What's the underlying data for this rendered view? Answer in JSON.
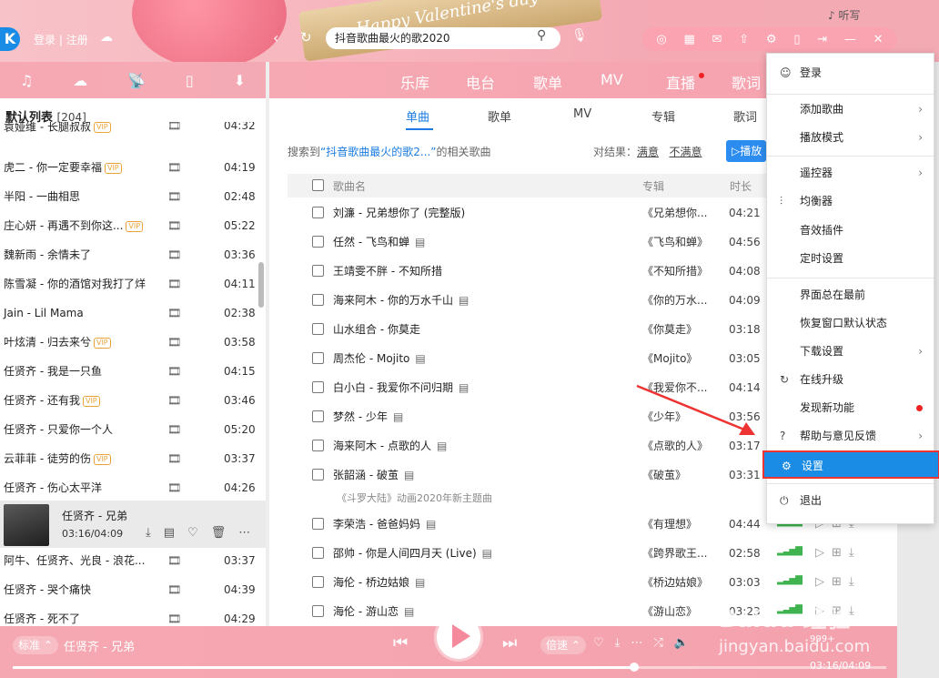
{
  "banner": {
    "decor_text": "Happy Valentine's day",
    "top_right_text": "♪ 听写"
  },
  "header": {
    "login": "登录",
    "register": "注册",
    "search_value": "抖音歌曲最火的歌2020"
  },
  "left_tabs": [
    "♫",
    "☁",
    "📡",
    "▯",
    "⬇"
  ],
  "playlist": {
    "title": "默认列表",
    "count": "[204]",
    "rows": [
      {
        "name": "袁娅维 - 长腿叔叔",
        "vip": "VIP",
        "duration": "04:32"
      },
      {
        "name": "虎二 - 你一定要幸福",
        "vip": "VIP",
        "duration": "04:19"
      },
      {
        "name": "半阳 - 一曲相思",
        "vip": "",
        "duration": "02:48"
      },
      {
        "name": "庄心妍 - 再遇不到你这...",
        "vip": "VIP",
        "duration": "05:22"
      },
      {
        "name": "魏新雨 - 余情未了",
        "vip": "",
        "duration": "03:36"
      },
      {
        "name": "陈雪凝 - 你的酒馆对我打了烊",
        "vip": "",
        "duration": "04:11"
      },
      {
        "name": "Jain - Lil Mama",
        "vip": "",
        "duration": "02:38"
      },
      {
        "name": "叶炫清 - 归去来兮",
        "vip": "VIP",
        "duration": "03:58"
      },
      {
        "name": "任贤齐 - 我是一只鱼",
        "vip": "",
        "duration": "04:15"
      },
      {
        "name": "任贤齐 - 还有我",
        "vip": "VIP",
        "duration": "03:46"
      },
      {
        "name": "任贤齐 - 只爱你一个人",
        "vip": "",
        "duration": "05:20"
      },
      {
        "name": "云菲菲 - 徒劳的伤",
        "vip": "VIP",
        "duration": "03:37"
      },
      {
        "name": "任贤齐 - 伤心太平洋",
        "vip": "",
        "duration": "04:26"
      }
    ],
    "playing": {
      "name": "任贤齐 - 兄弟",
      "time": "03:16/04:09"
    },
    "rows_after": [
      {
        "name": "阿牛、任贤齐、光良 - 浪花...",
        "vip": "",
        "duration": "03:37"
      },
      {
        "name": "任贤齐 - 哭个痛快",
        "vip": "",
        "duration": "04:39"
      },
      {
        "name": "任贤齐 - 死不了",
        "vip": "",
        "duration": "04:29"
      }
    ]
  },
  "main_tabs": [
    "乐库",
    "电台",
    "歌单",
    "MV",
    "直播",
    "歌词"
  ],
  "sub_tabs": [
    "单曲",
    "歌单",
    "MV",
    "专辑",
    "歌词"
  ],
  "result": {
    "prefix": "搜索到",
    "query": "“抖音歌曲最火的歌2...”",
    "suffix": "的相关歌曲",
    "feedback_label": "对结果：",
    "satisfied": "满意",
    "unsatisfied": "不满意",
    "play_all": "播放"
  },
  "table_headers": {
    "name": "歌曲名",
    "album": "专辑",
    "duration": "时长"
  },
  "songs": [
    {
      "name": "刘濂 - 兄弟想你了 (完整版)",
      "mv": "",
      "album": "《兄弟想你...",
      "duration": "04:21"
    },
    {
      "name": "任然 - 飞鸟和蝉",
      "mv": "🎞",
      "album": "《飞鸟和蝉》",
      "duration": "04:56"
    },
    {
      "name": "王靖雯不胖 - 不知所措",
      "mv": "",
      "album": "《不知所措》",
      "duration": "04:08"
    },
    {
      "name": "海来阿木 - 你的万水千山",
      "mv": "🎞",
      "album": "《你的万水...",
      "duration": "04:09"
    },
    {
      "name": "山水组合 - 你莫走",
      "mv": "",
      "album": "《你莫走》",
      "duration": "03:18"
    },
    {
      "name": "周杰伦 - Mojito",
      "mv": "🎞",
      "album": "《Mojito》",
      "duration": "03:05"
    },
    {
      "name": "白小白 - 我爱你不问归期",
      "mv": "🎞",
      "album": "《我爱你不...",
      "duration": "04:14"
    },
    {
      "name": "梦然 - 少年",
      "mv": "🎞",
      "album": "《少年》",
      "duration": "03:56"
    },
    {
      "name": "海来阿木 - 点歌的人",
      "mv": "🎞",
      "album": "《点歌的人》",
      "duration": "03:17"
    },
    {
      "name": "张韶涵 - 破茧",
      "mv": "🎞",
      "album": "《破茧》",
      "duration": "03:31"
    },
    {
      "name": "李荣浩 - 爸爸妈妈",
      "mv": "🎞",
      "album": "《有理想》",
      "duration": "04:44"
    },
    {
      "name": "邵帅 - 你是人间四月天 (Live)",
      "mv": "🎞",
      "album": "《跨界歌王...",
      "duration": "02:58"
    },
    {
      "name": "海伦 - 桥边姑娘",
      "mv": "🎞",
      "album": "《桥边姑娘》",
      "duration": "03:03"
    },
    {
      "name": "海伦 - 游山恋",
      "mv": "🎞",
      "album": "《游山恋》",
      "duration": "03:23"
    }
  ],
  "song_note": "《斗罗大陆》动画2020年新主题曲",
  "menu": {
    "login": "登录",
    "add_song": "添加歌曲",
    "play_mode": "播放模式",
    "remote": "遥控器",
    "equalizer": "均衡器",
    "effects": "音效插件",
    "timer": "定时设置",
    "on_top": "界面总在最前",
    "restore": "恢复窗口默认状态",
    "download_settings": "下载设置",
    "upgrade": "在线升级",
    "new_features": "发现新功能",
    "help": "帮助与意见反馈",
    "settings": "设置",
    "exit": "退出"
  },
  "player": {
    "mode": "标准",
    "now_playing": "任贤齐 - 兄弟",
    "speed": "倍速",
    "time": "03:16/04:09",
    "lyric_count": "999+",
    "progress": 0.79
  },
  "watermark": {
    "line1": "Baidu 经验",
    "line2": "jingyan.baidu.com"
  },
  "colors": {
    "accent": "#1a8ce6",
    "pink": "#f6a8b2",
    "highlight_border": "#e33"
  }
}
